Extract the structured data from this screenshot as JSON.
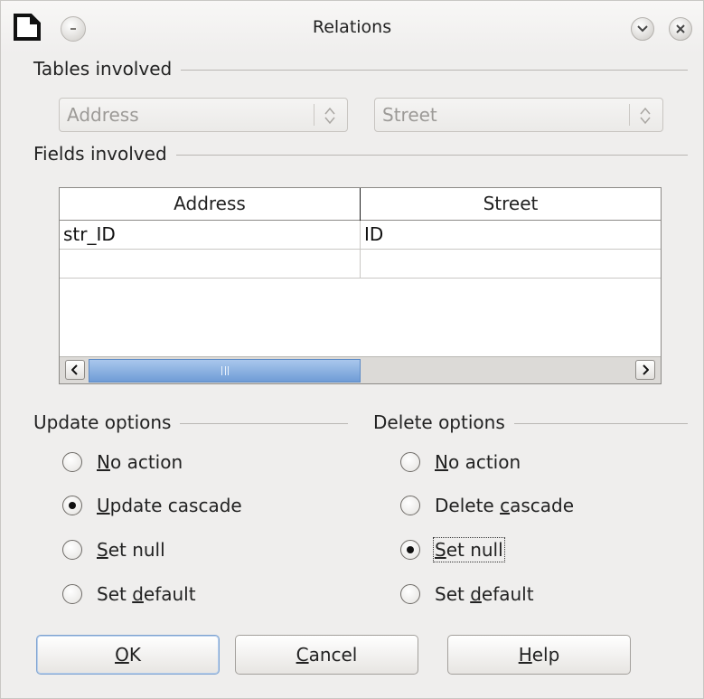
{
  "window": {
    "title": "Relations"
  },
  "tables_involved": {
    "heading": "Tables involved",
    "left_table": "Address",
    "right_table": "Street"
  },
  "fields_involved": {
    "heading": "Fields involved",
    "columns": [
      "Address",
      "Street"
    ],
    "rows": [
      [
        "str_ID",
        "ID"
      ],
      [
        "",
        ""
      ]
    ],
    "scroll_thumb_glyph": "III"
  },
  "update_options": {
    "heading": "Update options",
    "options": [
      {
        "label": "No action",
        "mnemonic": "N",
        "rest": "o action",
        "checked": false
      },
      {
        "label": "Update cascade",
        "mnemonic": "U",
        "rest": "pdate cascade",
        "checked": true
      },
      {
        "label": "Set null",
        "mnemonic": "S",
        "rest": "et null",
        "checked": false
      },
      {
        "label": "Set default",
        "prefix": "Set ",
        "mnemonic": "d",
        "rest": "efault",
        "checked": false
      }
    ]
  },
  "delete_options": {
    "heading": "Delete options",
    "options": [
      {
        "label": "No action",
        "mnemonic": "N",
        "rest": "o action",
        "checked": false
      },
      {
        "label": "Delete cascade",
        "prefix": "Delete ",
        "mnemonic": "c",
        "rest": "ascade",
        "checked": false
      },
      {
        "label": "Set null",
        "mnemonic": "S",
        "rest": "et null",
        "checked": true
      },
      {
        "label": "Set default",
        "prefix": "Set ",
        "mnemonic": "d",
        "rest": "efault",
        "checked": false
      }
    ]
  },
  "buttons": {
    "ok": {
      "mnemonic": "O",
      "rest": "K"
    },
    "cancel": {
      "mnemonic": "C",
      "rest": "ancel"
    },
    "help": {
      "mnemonic": "H",
      "rest": "elp"
    }
  }
}
